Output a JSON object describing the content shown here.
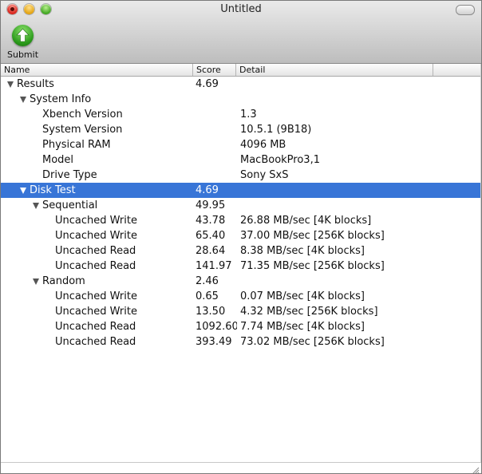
{
  "window": {
    "title": "Untitled"
  },
  "toolbar": {
    "submit_label": "Submit"
  },
  "table": {
    "columns": [
      "Name",
      "Score",
      "Detail"
    ],
    "rows": [
      {
        "name": "Results",
        "score": "4.69",
        "detail": ""
      },
      {
        "name": "System Info",
        "score": "",
        "detail": ""
      },
      {
        "name": "Xbench Version",
        "score": "",
        "detail": "1.3"
      },
      {
        "name": "System Version",
        "score": "",
        "detail": "10.5.1 (9B18)"
      },
      {
        "name": "Physical RAM",
        "score": "",
        "detail": "4096 MB"
      },
      {
        "name": "Model",
        "score": "",
        "detail": "MacBookPro3,1"
      },
      {
        "name": "Drive Type",
        "score": "",
        "detail": "Sony SxS"
      },
      {
        "name": "Disk Test",
        "score": "4.69",
        "detail": ""
      },
      {
        "name": "Sequential",
        "score": "49.95",
        "detail": ""
      },
      {
        "name": "Uncached Write",
        "score": "43.78",
        "detail": "26.88 MB/sec [4K blocks]"
      },
      {
        "name": "Uncached Write",
        "score": "65.40",
        "detail": "37.00 MB/sec [256K blocks]"
      },
      {
        "name": "Uncached Read",
        "score": "28.64",
        "detail": "8.38 MB/sec [4K blocks]"
      },
      {
        "name": "Uncached Read",
        "score": "141.97",
        "detail": "71.35 MB/sec [256K blocks]"
      },
      {
        "name": "Random",
        "score": "2.46",
        "detail": ""
      },
      {
        "name": "Uncached Write",
        "score": "0.65",
        "detail": "0.07 MB/sec [4K blocks]"
      },
      {
        "name": "Uncached Write",
        "score": "13.50",
        "detail": "4.32 MB/sec [256K blocks]"
      },
      {
        "name": "Uncached Read",
        "score": "1092.60",
        "detail": "7.74 MB/sec [4K blocks]"
      },
      {
        "name": "Uncached Read",
        "score": "393.49",
        "detail": "73.02 MB/sec [256K blocks]"
      }
    ]
  },
  "colors": {
    "selection": "#3875d7",
    "submit_green": "#2b9a1b"
  }
}
